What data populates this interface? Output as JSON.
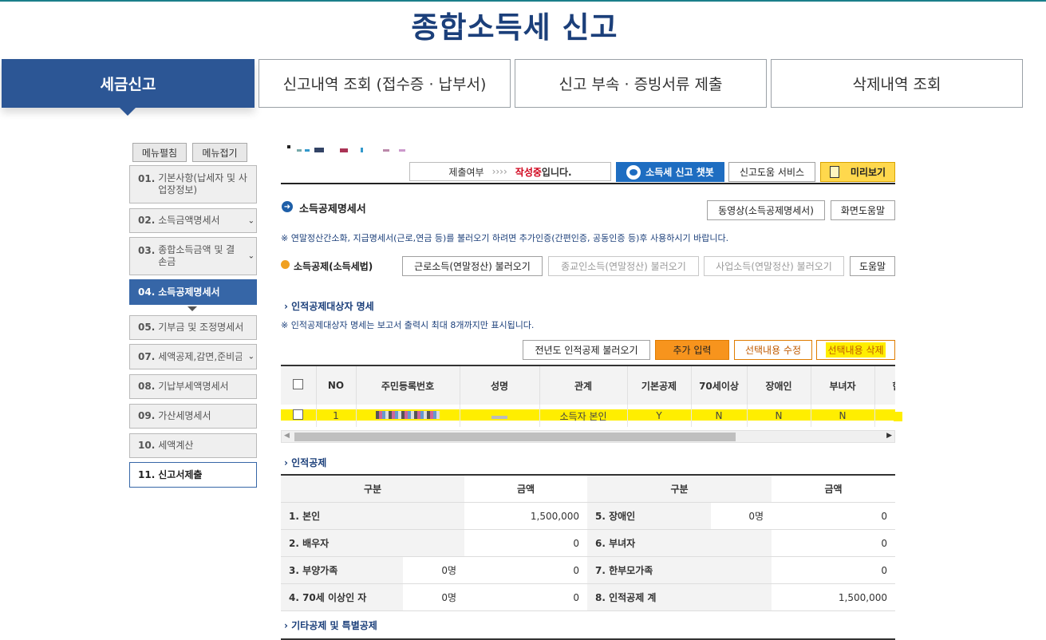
{
  "title": "종합소득세 신고",
  "tabs": [
    {
      "label": "세금신고"
    },
    {
      "label": "신고내역 조회 (접수증 · 납부서)"
    },
    {
      "label": "신고 부속 · 증빙서류 제출"
    },
    {
      "label": "삭제내역 조회"
    }
  ],
  "sidebar": {
    "expand_label": "메뉴펼침",
    "collapse_label": "메뉴접기",
    "items": [
      {
        "num": "01.",
        "label": "기본사항(납세자 및 사업장정보)"
      },
      {
        "num": "02.",
        "label": "소득금액명세서"
      },
      {
        "num": "03.",
        "label": "종합소득금액 및 결손금"
      },
      {
        "num": "04.",
        "label": "소득공제명세서"
      },
      {
        "num": "05.",
        "label": "기부금 및 조정명세서"
      },
      {
        "num": "07.",
        "label": "세액공제,감면,준비금"
      },
      {
        "num": "08.",
        "label": "기납부세액명세서"
      },
      {
        "num": "09.",
        "label": "가산세명세서"
      },
      {
        "num": "10.",
        "label": "세액계산"
      },
      {
        "num": "11.",
        "label": "신고서제출"
      }
    ]
  },
  "status": {
    "label": "제출여부",
    "arrows": "››››",
    "value": "작성중",
    "suffix": "입니다."
  },
  "buttons": {
    "chatbot": "소득세 신고 챗봇",
    "help_service": "신고도움 서비스",
    "preview": "미리보기",
    "video": "동영상(소득공제명세서)",
    "screen_help": "화면도움말",
    "load_earned": "근로소득(연말정산) 불러오기",
    "load_religious": "종교인소득(연말정산) 불러오기",
    "load_business": "사업소득(연말정산) 불러오기",
    "help": "도움말",
    "prev_year": "전년도 인적공제 불러오기",
    "add": "추가 입력",
    "edit": "선택내용 수정",
    "delete": "선택내용 삭제"
  },
  "section_title": "소득공제명세서",
  "notice": "※ 연말정산간소화, 지급명세서(근로,연금 등)를 불러오기 하려면 추가인증(간편인증, 공동인증 등)후 사용하시기 바랍니다.",
  "sub_title": "소득공제(소득세법)",
  "dependents": {
    "title": "인적공제대상자 명세",
    "note": "※ 인적공제대상자 명세는 보고서 출력시 최대 8개까지만 표시됩니다.",
    "columns": [
      "NO",
      "주민등록번호",
      "성명",
      "관계",
      "기본공제",
      "70세이상",
      "장애인",
      "부녀자",
      "한"
    ],
    "rows": [
      {
        "no": "1",
        "relation": "소득자 본인",
        "basic": "Y",
        "over70": "N",
        "disabled": "N",
        "woman": "N"
      }
    ]
  },
  "personal": {
    "title": "인적공제",
    "headers": [
      "구분",
      "금액",
      "구분",
      "금액"
    ],
    "rows": [
      {
        "l_label": "1. 본인",
        "l_count": "",
        "l_amount": "1,500,000",
        "r_label": "5. 장애인",
        "r_count": "0명",
        "r_amount": "0"
      },
      {
        "l_label": "2. 배우자",
        "l_count": "",
        "l_amount": "0",
        "r_label": "6. 부녀자",
        "r_count": "",
        "r_amount": "0"
      },
      {
        "l_label": "3. 부양가족",
        "l_count": "0명",
        "l_amount": "0",
        "r_label": "7. 한부모가족",
        "r_count": "",
        "r_amount": "0"
      },
      {
        "l_label": "4. 70세 이상인 자",
        "l_count": "0명",
        "l_amount": "0",
        "r_label": "8. 인적공제 계",
        "r_count": "",
        "r_amount": "1,500,000"
      }
    ]
  },
  "other_title": "기타공제 및 특별공제"
}
